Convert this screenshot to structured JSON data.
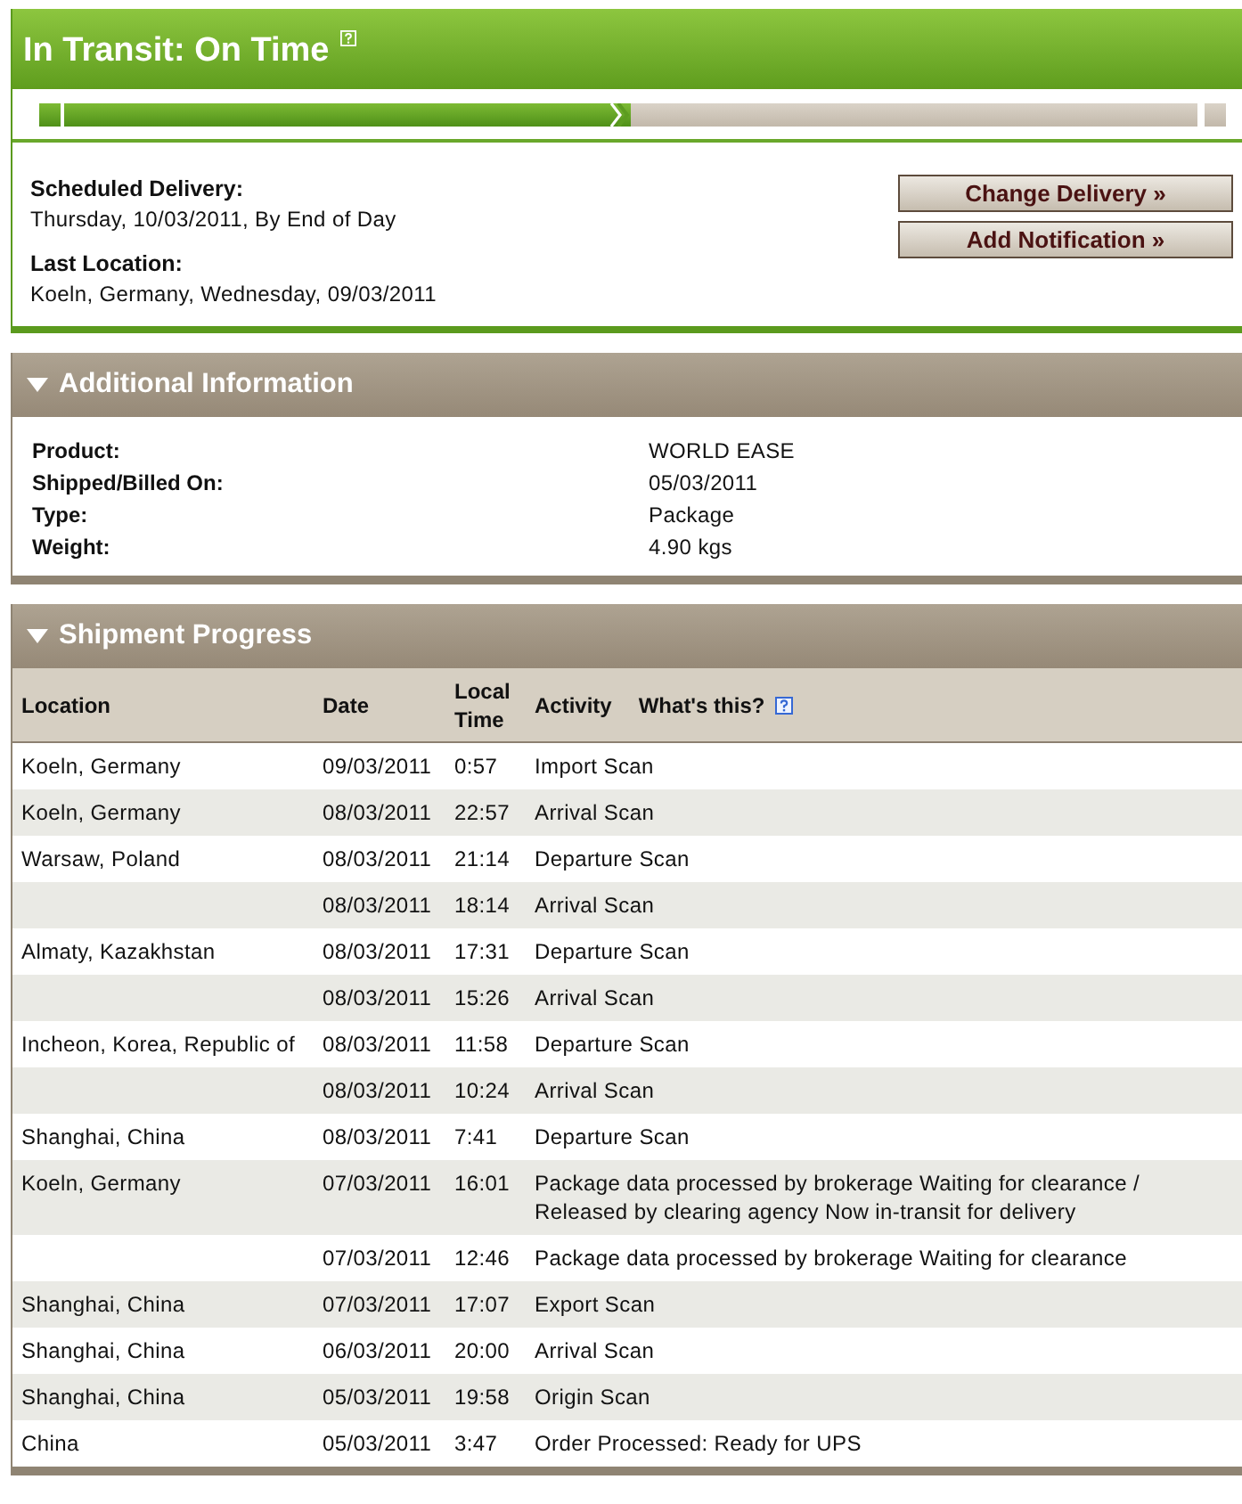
{
  "status": {
    "title": "In Transit: On Time",
    "progress": {
      "level": 0.5
    }
  },
  "delivery": {
    "fields": [
      {
        "label": "Scheduled Delivery:",
        "value": "Thursday, 10/03/2011, By End of Day"
      },
      {
        "label": "Last Location:",
        "value": "Koeln, Germany, Wednesday, 09/03/2011"
      }
    ],
    "buttons": [
      "Change Delivery »",
      "Add Notification »"
    ]
  },
  "additional_information": {
    "title": "Additional Information",
    "expanded": true,
    "rows": [
      {
        "label": "Product:",
        "value": "WORLD EASE"
      },
      {
        "label": "Shipped/Billed On:",
        "value": "05/03/2011"
      },
      {
        "label": "Type:",
        "value": "Package"
      },
      {
        "label": "Weight:",
        "value": "4.90 kgs"
      }
    ]
  },
  "shipment_progress": {
    "title": "Shipment Progress",
    "expanded": true,
    "columns": [
      "Location",
      "Date",
      "Local Time",
      "Activity"
    ],
    "help_link": "What's this?",
    "rows": [
      {
        "location": "Koeln, Germany",
        "date": "09/03/2011",
        "time": "0:57",
        "activity": "Import Scan"
      },
      {
        "location": "Koeln, Germany",
        "date": "08/03/2011",
        "time": "22:57",
        "activity": "Arrival Scan"
      },
      {
        "location": "Warsaw, Poland",
        "date": "08/03/2011",
        "time": "21:14",
        "activity": "Departure Scan"
      },
      {
        "date": "08/03/2011",
        "time": "18:14",
        "activity": "Arrival Scan"
      },
      {
        "location": "Almaty, Kazakhstan",
        "date": "08/03/2011",
        "time": "17:31",
        "activity": "Departure Scan"
      },
      {
        "date": "08/03/2011",
        "time": "15:26",
        "activity": "Arrival Scan"
      },
      {
        "location": "Incheon, Korea, Republic of",
        "date": "08/03/2011",
        "time": "11:58",
        "activity": "Departure Scan"
      },
      {
        "date": "08/03/2011",
        "time": "10:24",
        "activity": "Arrival Scan"
      },
      {
        "location": "Shanghai, China",
        "date": "08/03/2011",
        "time": "7:41",
        "activity": "Departure Scan"
      },
      {
        "location": "Koeln, Germany",
        "date": "07/03/2011",
        "time": "16:01",
        "activity": "Package data processed by brokerage Waiting for clearance / Released by clearing agency Now in-transit for delivery"
      },
      {
        "date": "07/03/2011",
        "time": "12:46",
        "activity": "Package data processed by brokerage Waiting for clearance"
      },
      {
        "location": "Shanghai, China",
        "date": "07/03/2011",
        "time": "17:07",
        "activity": "Export Scan"
      },
      {
        "location": "Shanghai, China",
        "date": "06/03/2011",
        "time": "20:00",
        "activity": "Arrival Scan"
      },
      {
        "location": "Shanghai, China",
        "date": "05/03/2011",
        "time": "19:58",
        "activity": "Origin Scan"
      },
      {
        "location": "China",
        "date": "05/03/2011",
        "time": "3:47",
        "activity": "Order Processed: Ready for UPS"
      }
    ]
  }
}
